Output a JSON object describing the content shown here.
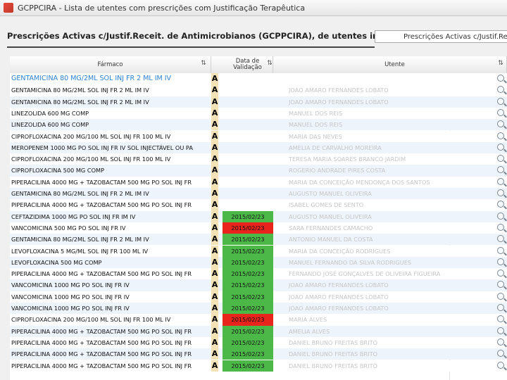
{
  "window": {
    "title": "GCPPCIRA - Lista de utentes com prescrições com Justificação Terapêutica"
  },
  "panel": {
    "title": "Prescrições Activas c/Justif.Receit. de Antimicrobianos (GCPPCIRA), de utentes internados",
    "side_tab": "Prescrições Activas c/Justif.Receit."
  },
  "columns": {
    "drug": "Fármaco",
    "date": "Data de Validação",
    "patient": "Utente"
  },
  "status_colors": {
    "valid": "#4cb848",
    "expired": "#e8241c",
    "flag_bg": "#f3e2b6",
    "selected_text": "#2a7fd0"
  },
  "icons": {
    "sort": "sort-icon",
    "view": "magnifier-icon"
  },
  "rows": [
    {
      "drug": "GENTAMICINA 80 MG/2ML SOL INJ FR 2 ML IM IV",
      "flag": "A",
      "date": "",
      "date_status": "",
      "patient": ""
    },
    {
      "drug": "GENTAMICINA 80 MG/2ML SOL INJ FR 2 ML IM IV",
      "flag": "A",
      "date": "",
      "date_status": "",
      "patient": "JOAO AMARO FERNANDES LOBATO"
    },
    {
      "drug": "GENTAMICINA 80 MG/2ML SOL INJ FR 2 ML IM IV",
      "flag": "A",
      "date": "",
      "date_status": "",
      "patient": "JOAO AMARO FERNANDES LOBATO"
    },
    {
      "drug": "LINEZOLIDA 600 MG COMP",
      "flag": "A",
      "date": "",
      "date_status": "",
      "patient": "MANUEL DOS REIS"
    },
    {
      "drug": "LINEZOLIDA 600 MG COMP",
      "flag": "A",
      "date": "",
      "date_status": "",
      "patient": "MANUEL DOS REIS"
    },
    {
      "drug": "CIPROFLOXACINA 200 MG/100 ML SOL INJ FR 100 ML IV",
      "flag": "A",
      "date": "",
      "date_status": "",
      "patient": "MARIA DAS NEVES"
    },
    {
      "drug": "MEROPENEM 1000 MG PO SOL INJ FR IV SOL INJECTÁVEL OU PA",
      "flag": "A",
      "date": "",
      "date_status": "",
      "patient": "AMELIA DE CARVALHO MOREIRA"
    },
    {
      "drug": "CIPROFLOXACINA 200 MG/100 ML SOL INJ FR 100 ML IV",
      "flag": "A",
      "date": "",
      "date_status": "",
      "patient": "TERESA MARIA SOARES BRANCO JARDIM"
    },
    {
      "drug": "CIPROFLOXACINA 500 MG COMP",
      "flag": "A",
      "date": "",
      "date_status": "",
      "patient": "ROGERIO ANDRADE PIRES COSTA"
    },
    {
      "drug": "PIPERACILINA 4000 MG + TAZOBACTAM 500 MG PO SOL INJ FR",
      "flag": "A",
      "date": "",
      "date_status": "",
      "patient": "MARIA DA CONCEIÇÃO MENDONÇA DOS SANTOS"
    },
    {
      "drug": "GENTAMICINA 80 MG/2ML SOL INJ FR 2 ML IM IV",
      "flag": "A",
      "date": "",
      "date_status": "",
      "patient": "AUGUSTO MANUEL OLIVEIRA"
    },
    {
      "drug": "PIPERACILINA 4000 MG + TAZOBACTAM 500 MG PO SOL INJ FR",
      "flag": "A",
      "date": "",
      "date_status": "",
      "patient": "ISABEL GOMES DE SENTO"
    },
    {
      "drug": "CEFTAZIDIMA 1000 MG PO SOL INJ FR IM IV",
      "flag": "A",
      "date": "2015/02/23",
      "date_status": "valid",
      "patient": "AUGUSTO MANUEL OLIVEIRA"
    },
    {
      "drug": "VANCOMICINA 500 MG PO SOL INJ FR IV",
      "flag": "A",
      "date": "2015/02/23",
      "date_status": "expired",
      "patient": "SARA FERNANDES CAMACHO"
    },
    {
      "drug": "GENTAMICINA 80 MG/2ML SOL INJ FR 2 ML IM IV",
      "flag": "A",
      "date": "2015/02/23",
      "date_status": "valid",
      "patient": "ANTONIO MANUEL DA COSTA"
    },
    {
      "drug": "LEVOFLOXACINA 5 MG/ML SOL INJ FR 100 ML IV",
      "flag": "A",
      "date": "2015/02/23",
      "date_status": "valid",
      "patient": "MARIA DA CONCEIÇÃO RODRIGUES"
    },
    {
      "drug": "LEVOFLOXACINA 500 MG COMP",
      "flag": "A",
      "date": "2015/02/23",
      "date_status": "valid",
      "patient": "MANUEL FERNANDO DA SILVA RODRIGUES"
    },
    {
      "drug": "PIPERACILINA 4000 MG + TAZOBACTAM 500 MG PO SOL INJ FR",
      "flag": "A",
      "date": "2015/02/23",
      "date_status": "valid",
      "patient": "FERNANDO JOSÉ GONÇALVES DE OLIVEIRA FIGUEIRA"
    },
    {
      "drug": "VANCOMICINA 1000 MG PO SOL INJ FR IV",
      "flag": "A",
      "date": "2015/02/23",
      "date_status": "valid",
      "patient": "JOAO AMARO FERNANDES LOBATO"
    },
    {
      "drug": "VANCOMICINA 1000 MG PO SOL INJ FR IV",
      "flag": "A",
      "date": "2015/02/23",
      "date_status": "valid",
      "patient": "JOAO AMARO FERNANDES LOBATO"
    },
    {
      "drug": "VANCOMICINA 1000 MG PO SOL INJ FR IV",
      "flag": "A",
      "date": "2015/02/23",
      "date_status": "valid",
      "patient": "JOAO AMARO FERNANDES LOBATO"
    },
    {
      "drug": "CIPROFLOXACINA 200 MG/100 ML SOL INJ FR 100 ML IV",
      "flag": "A",
      "date": "2015/02/23",
      "date_status": "expired",
      "patient": "MARIA ALVES"
    },
    {
      "drug": "PIPERACILINA 4000 MG + TAZOBACTAM 500 MG PO SOL INJ FR",
      "flag": "A",
      "date": "2015/02/23",
      "date_status": "valid",
      "patient": "AMELIA ALVES"
    },
    {
      "drug": "PIPERACILINA 4000 MG + TAZOBACTAM 500 MG PO SOL INJ FR",
      "flag": "A",
      "date": "2015/02/23",
      "date_status": "valid",
      "patient": "DANIEL BRUNO FREITAS BRITO"
    },
    {
      "drug": "PIPERACILINA 4000 MG + TAZOBACTAM 500 MG PO SOL INJ FR",
      "flag": "A",
      "date": "2015/02/23",
      "date_status": "valid",
      "patient": "DANIEL BRUNO FREITAS BRITO"
    },
    {
      "drug": "PIPERACILINA 4000 MG + TAZOBACTAM 500 MG PO SOL INJ FR",
      "flag": "A",
      "date": "2015/02/23",
      "date_status": "valid",
      "patient": "DANIEL BRUNO FREITAS BRITO"
    }
  ]
}
